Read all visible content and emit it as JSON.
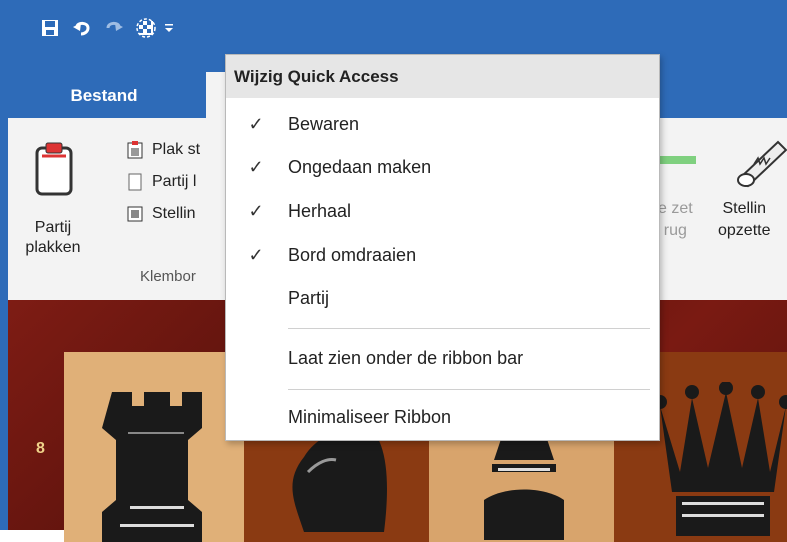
{
  "quick_access": {
    "icons": [
      "save-icon",
      "undo-icon",
      "redo-icon",
      "flip-board-icon",
      "customize-dropdown-icon"
    ]
  },
  "tabs": {
    "file_label": "Bestand"
  },
  "ribbon": {
    "paste_game_label_line1": "Partij",
    "paste_game_label_line2": "plakken",
    "small_buttons": [
      "Plak st",
      "Partij l",
      "Stellin"
    ],
    "group_label": "Klembor",
    "right_btn1_line1": "e zet",
    "right_btn1_line2": "rug",
    "right_btn2_line1": "Stellin",
    "right_btn2_line2": "opzette"
  },
  "board": {
    "rank_label": "8"
  },
  "menu": {
    "header": "Wijzig Quick Access",
    "items": [
      {
        "label": "Bewaren",
        "checked": "✓"
      },
      {
        "label": "Ongedaan maken",
        "checked": "✓"
      },
      {
        "label": "Herhaal",
        "checked": "✓"
      },
      {
        "label": "Bord omdraaien",
        "checked": "✓"
      },
      {
        "label": "Partij",
        "checked": ""
      }
    ],
    "show_below_label": "Laat zien onder de ribbon bar",
    "minimize_label": "Minimaliseer Ribbon"
  },
  "colors": {
    "titlebar": "#2e6bb8",
    "ribbon_bg": "#f3f3f3",
    "board_frame": "#6e1710",
    "light_square": "#d9a06a"
  }
}
